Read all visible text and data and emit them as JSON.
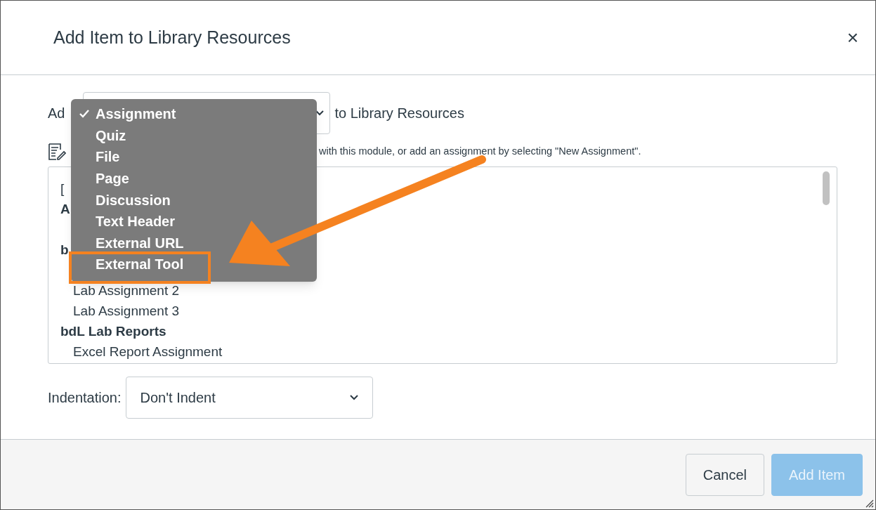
{
  "dialog": {
    "title": "Add Item to Library Resources",
    "close": "×"
  },
  "add_row": {
    "prefix": "Ad",
    "suffix": "to Library Resources"
  },
  "description": "with this module, or add an assignment by selecting \"New Assignment\".",
  "list": {
    "items": [
      {
        "kind": "plain",
        "text": "["
      },
      {
        "kind": "group",
        "text": "A"
      },
      {
        "kind": "group",
        "text": "b"
      },
      {
        "kind": "item",
        "text": "Lab Assignment 2"
      },
      {
        "kind": "item",
        "text": "Lab Assignment 3"
      },
      {
        "kind": "group",
        "text": "bdL Lab Reports"
      },
      {
        "kind": "item",
        "text": "Excel Report Assignment"
      }
    ]
  },
  "type_menu": {
    "options": [
      {
        "label": "Assignment",
        "selected": true
      },
      {
        "label": "Quiz",
        "selected": false
      },
      {
        "label": "File",
        "selected": false
      },
      {
        "label": "Page",
        "selected": false
      },
      {
        "label": "Discussion",
        "selected": false
      },
      {
        "label": "Text Header",
        "selected": false
      },
      {
        "label": "External URL",
        "selected": false
      },
      {
        "label": "External Tool",
        "selected": false
      }
    ]
  },
  "indentation": {
    "label": "Indentation:",
    "value": "Don't Indent"
  },
  "buttons": [
    {
      "label": "Cancel",
      "kind": "secondary"
    },
    {
      "label": "Add Item",
      "kind": "primary"
    }
  ]
}
